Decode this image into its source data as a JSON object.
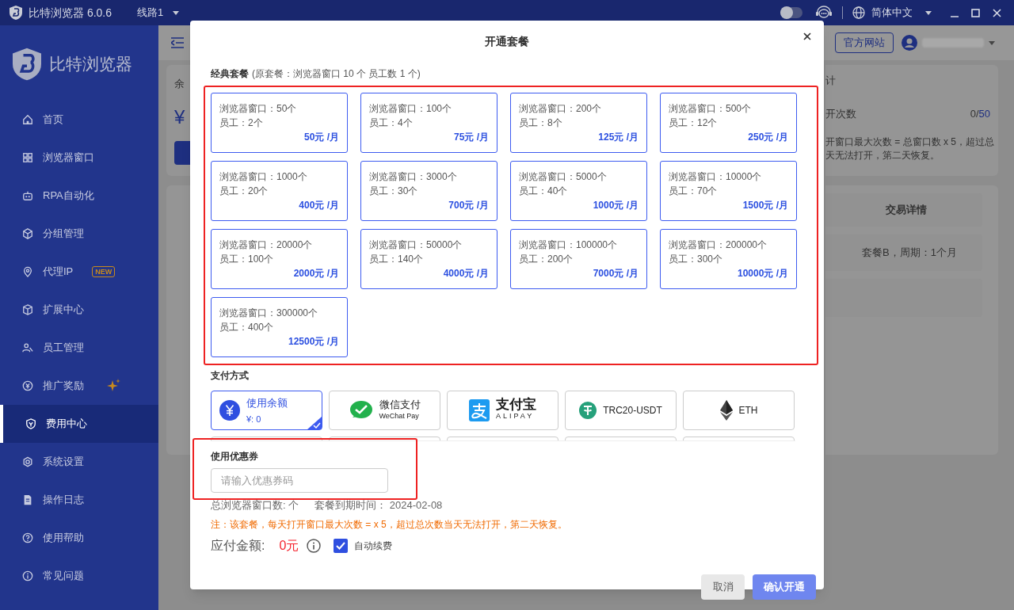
{
  "titlebar": {
    "app_title": "比特浏览器 6.0.6",
    "line": "线路1",
    "dark_mode": false,
    "language": "简体中文"
  },
  "sidebar": {
    "logo_text": "比特浏览器",
    "items": [
      {
        "label": "首页",
        "selected": false
      },
      {
        "label": "浏览器窗口",
        "selected": false
      },
      {
        "label": "RPA自动化",
        "selected": false
      },
      {
        "label": "分组管理",
        "selected": false
      },
      {
        "label": "代理IP",
        "selected": false,
        "badge": "NEW"
      },
      {
        "label": "扩展中心",
        "selected": false
      },
      {
        "label": "员工管理",
        "selected": false
      },
      {
        "label": "推广奖励",
        "selected": false
      },
      {
        "label": "费用中心",
        "selected": true
      },
      {
        "label": "系统设置",
        "selected": false
      },
      {
        "label": "操作日志",
        "selected": false
      },
      {
        "label": "使用帮助",
        "selected": false
      },
      {
        "label": "常见问题",
        "selected": false
      }
    ]
  },
  "header": {
    "website_button": "官方网站"
  },
  "background": {
    "balance_label": "余",
    "balance_value": "¥",
    "right_heading": "计",
    "open_count_label": "开次数",
    "open_count_used": "0/",
    "open_count_total": "50",
    "rule_lines": [
      "开窗口最大次数 = 总窗口数 x 5，超过总",
      "天无法打开，第二天恢复。"
    ],
    "table_header": "交易详情",
    "table_cell": "套餐B，周期：1个月"
  },
  "dialog": {
    "title": "开通套餐",
    "plans_heading": "经典套餐",
    "plans_note": "(原套餐：浏览器窗口 10 个 员工数 1 个)",
    "plans": [
      {
        "windows": "浏览器窗口：50个",
        "staff": "员工：2个",
        "price": "50元 /月"
      },
      {
        "windows": "浏览器窗口：100个",
        "staff": "员工：4个",
        "price": "75元 /月"
      },
      {
        "windows": "浏览器窗口：200个",
        "staff": "员工：8个",
        "price": "125元 /月"
      },
      {
        "windows": "浏览器窗口：500个",
        "staff": "员工：12个",
        "price": "250元 /月"
      },
      {
        "windows": "浏览器窗口：1000个",
        "staff": "员工：20个",
        "price": "400元 /月"
      },
      {
        "windows": "浏览器窗口：3000个",
        "staff": "员工：30个",
        "price": "700元 /月"
      },
      {
        "windows": "浏览器窗口：5000个",
        "staff": "员工：40个",
        "price": "1000元 /月"
      },
      {
        "windows": "浏览器窗口：10000个",
        "staff": "员工：70个",
        "price": "1500元 /月"
      },
      {
        "windows": "浏览器窗口：20000个",
        "staff": "员工：100个",
        "price": "2000元 /月"
      },
      {
        "windows": "浏览器窗口：50000个",
        "staff": "员工：140个",
        "price": "4000元 /月"
      },
      {
        "windows": "浏览器窗口：100000个",
        "staff": "员工：200个",
        "price": "7000元 /月"
      },
      {
        "windows": "浏览器窗口：200000个",
        "staff": "员工：300个",
        "price": "10000元 /月"
      },
      {
        "windows": "浏览器窗口：300000个",
        "staff": "员工：400个",
        "price": "12500元 /月"
      }
    ],
    "payment_heading": "支付方式",
    "payments": [
      {
        "kind": "balance",
        "label": "使用余额",
        "sub": "¥: 0",
        "selected": true
      },
      {
        "kind": "wechat",
        "label": "微信支付",
        "sub": "WeChat Pay",
        "selected": false
      },
      {
        "kind": "alipay",
        "label": "支付宝",
        "sub": "ALIPAY",
        "selected": false
      },
      {
        "kind": "usdt",
        "label": "TRC20-USDT",
        "selected": false
      },
      {
        "kind": "eth",
        "label": "ETH",
        "selected": false
      }
    ],
    "coupon_label": "使用优惠券",
    "coupon_placeholder": "请输入优惠券码",
    "total_windows": "总浏览器窗口数: 个",
    "expiry": "套餐到期时间： 2024-02-08",
    "note": "注：该套餐，每天打开窗口最大次数 = x 5，超过总次数当天无法打开，第二天恢复。",
    "amount_label": "应付金额:",
    "amount_value": "0元",
    "auto_renew": {
      "label": "自动续费",
      "checked": true
    },
    "cancel_button": "取消",
    "confirm_button": "确认开通"
  }
}
